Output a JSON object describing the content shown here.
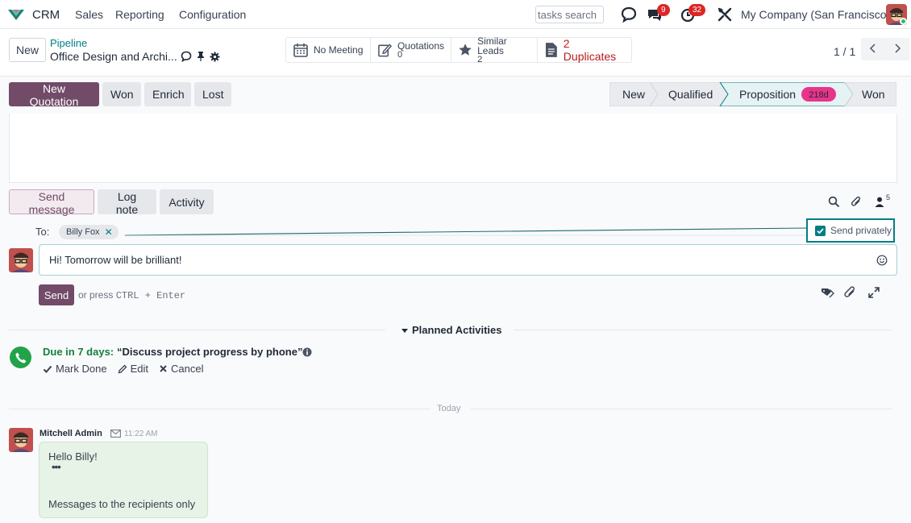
{
  "navbar": {
    "app_name": "CRM",
    "menu": [
      "Sales",
      "Reporting",
      "Configuration"
    ],
    "search_placeholder": "tasks search",
    "messages_badge": "9",
    "activities_badge": "32",
    "company": "My Company (San Francisco)"
  },
  "control": {
    "new_label": "New",
    "breadcrumb_parent": "Pipeline",
    "record_title": "Office Design and Archi...",
    "smart_buttons": {
      "meeting": "No Meeting",
      "quotations_label": "Quotations",
      "quotations_count": "0",
      "similar_label": "Similar Leads",
      "similar_count": "2",
      "duplicates": "2 Duplicates"
    },
    "pager": "1 / 1"
  },
  "statusbar": {
    "buttons": [
      "New Quotation",
      "Won",
      "Enrich",
      "Lost"
    ],
    "stages": [
      "New",
      "Qualified",
      "Proposition",
      "Won"
    ],
    "active_stage_badge": "218d"
  },
  "chatter": {
    "tabs": [
      "Send message",
      "Log note",
      "Activity"
    ],
    "followers_count": "5",
    "to_label": "To:",
    "recipient": "Billy Fox",
    "send_privately": "Send privately",
    "composer_text": "Hi! Tomorrow will be brilliant!",
    "send_label": "Send",
    "hint_prefix": "or press",
    "hint_keys": "CTRL + Enter",
    "planned_title": "Planned Activities",
    "activity": {
      "due": "Due in 7 days:",
      "summary": "“Discuss project progress by phone”",
      "actions": [
        "Mark Done",
        "Edit",
        "Cancel"
      ]
    },
    "date_separator": "Today",
    "message": {
      "author": "Mitchell Admin",
      "time": "11:22 AM",
      "body": "Hello Billy!",
      "dots": "•••",
      "note": "Messages to the recipients only"
    }
  },
  "colors": {
    "primary": "#714b67",
    "accent": "#017e84",
    "danger_badge": "#dc2626",
    "stage_badge": "#e9348b",
    "success": "#15803d"
  }
}
